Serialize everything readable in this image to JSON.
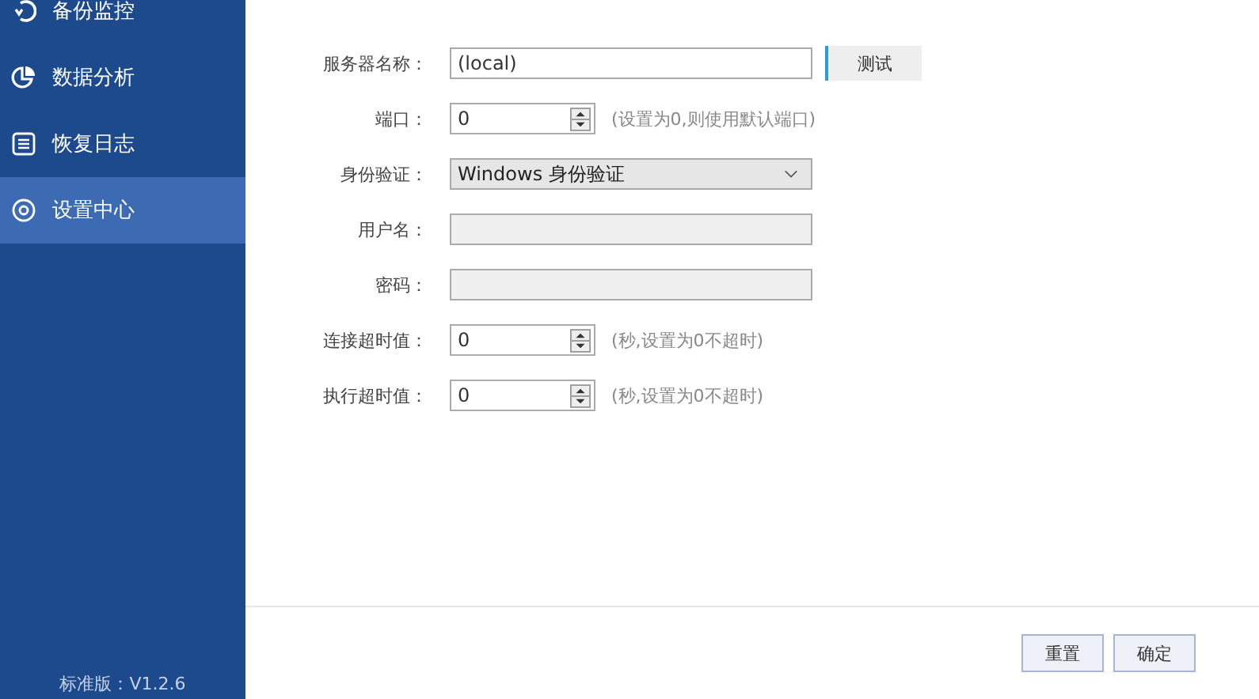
{
  "sidebar": {
    "items": [
      {
        "label": "备份监控",
        "selected": false
      },
      {
        "label": "数据分析",
        "selected": false
      },
      {
        "label": "恢复日志",
        "selected": false
      },
      {
        "label": "设置中心",
        "selected": true
      }
    ],
    "version": "标准版：V1.2.6"
  },
  "form": {
    "rows": [
      {
        "kind": "text",
        "label": "服务器名称：",
        "value": "(local)",
        "button": "测试"
      },
      {
        "kind": "spin",
        "label": "端口：",
        "value": "0",
        "hint": "(设置为0,则使用默认端口)"
      },
      {
        "kind": "select",
        "label": "身份验证：",
        "value": "Windows 身份验证"
      },
      {
        "kind": "text",
        "label": "用户名：",
        "disabled": true
      },
      {
        "kind": "text",
        "label": "密码：",
        "disabled": true
      },
      {
        "kind": "spin",
        "label": "连接超时值：",
        "value": "0",
        "hint": "(秒,设置为0不超时)"
      },
      {
        "kind": "spin",
        "label": "执行超时值：",
        "value": "0",
        "hint": "(秒,设置为0不超时)"
      }
    ]
  },
  "footer": {
    "buttons": [
      "重置",
      "确定"
    ]
  }
}
